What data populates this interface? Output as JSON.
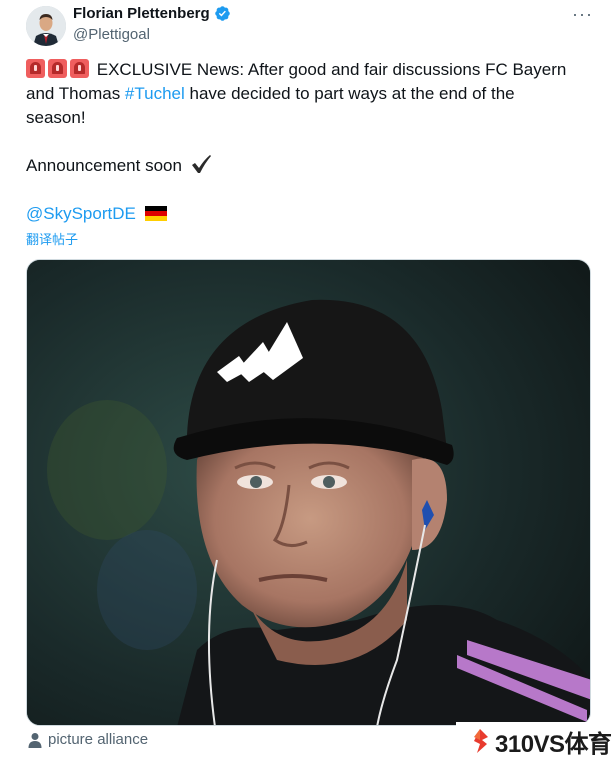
{
  "author": {
    "display_name": "Florian Plettenberg",
    "handle": "@Plettigoal",
    "verified": true
  },
  "more_menu_label": "···",
  "tweet": {
    "line1_text": "EXCLUSIVE News: After good and fair discussions FC Bayern",
    "line2_prefix": "and Thomas ",
    "hashtag": "#Tuchel",
    "line2_suffix": " have decided to part ways at the end of the",
    "line3_text": "season!",
    "announcement": "Announcement soon",
    "mention": "@SkySportDE"
  },
  "translate_label": "翻译帖子",
  "media": {
    "credit": "picture alliance"
  },
  "watermark": {
    "text": "310VS体育"
  },
  "colors": {
    "link": "#1d9bf0",
    "verified": "#1d9bf0",
    "secondary_text": "#536471",
    "siren": "#ef5e5e"
  },
  "icons": {
    "emoji_start": [
      "police-light-icon",
      "police-light-icon",
      "police-light-icon"
    ],
    "emoji_after_announcement": "check-mark-icon",
    "emoji_after_mention": "germany-flag-icon"
  }
}
